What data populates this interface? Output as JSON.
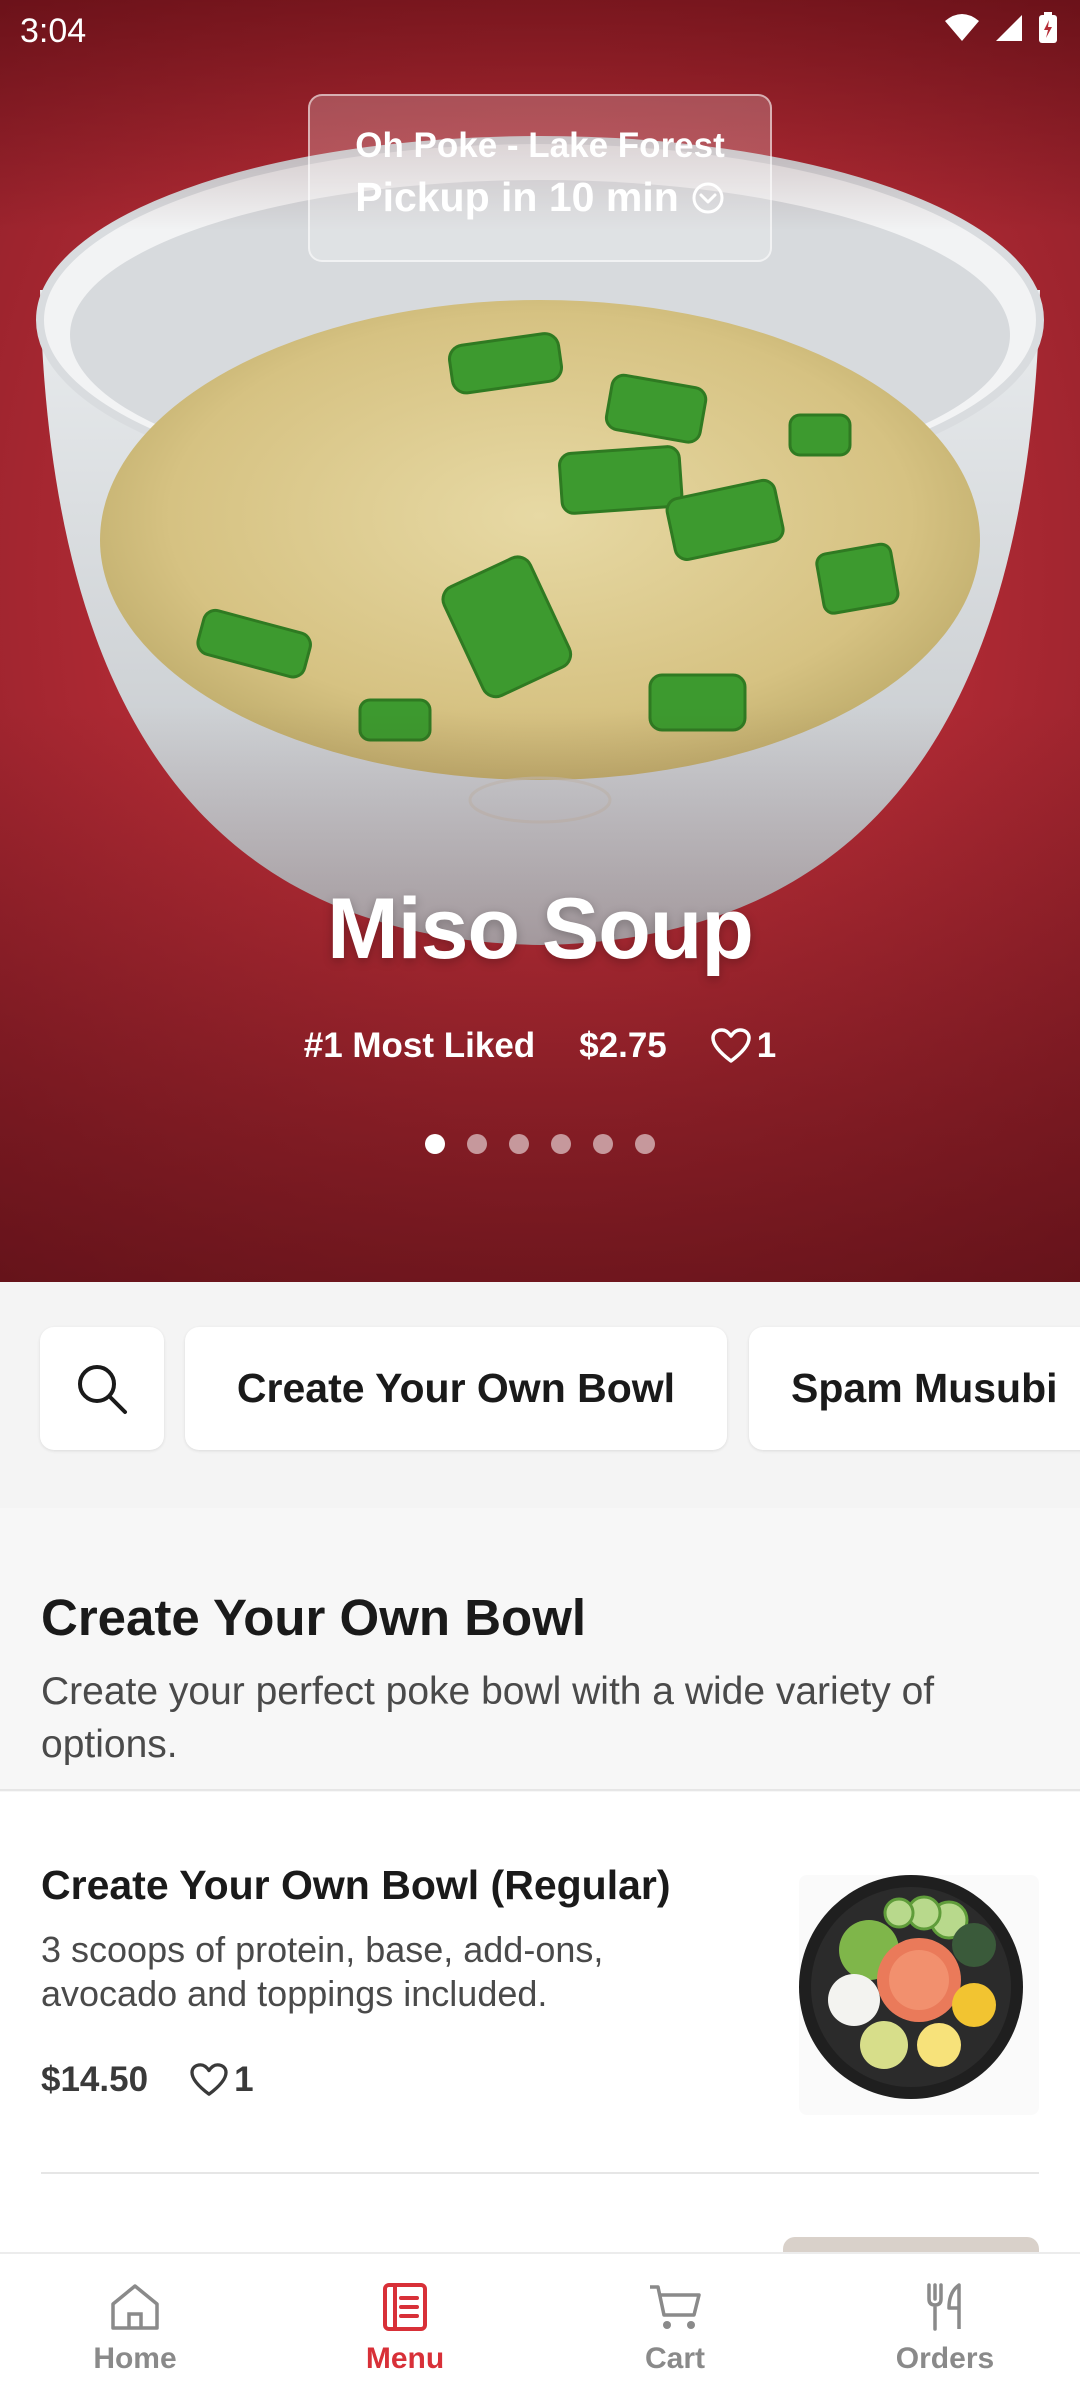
{
  "status_bar": {
    "time": "3:04"
  },
  "store": {
    "name": "Oh Poke - Lake Forest",
    "pickup": "Pickup in 10 min"
  },
  "hero": {
    "title": "Miso Soup",
    "rank": "#1 Most Liked",
    "price": "$2.75",
    "likes": "1",
    "carousel_total": 6,
    "carousel_active": 0
  },
  "categories": [
    "Create Your Own Bowl",
    "Spam Musubi"
  ],
  "section": {
    "title": "Create Your Own Bowl",
    "description": "Create your perfect poke bowl with a wide variety of options."
  },
  "items": [
    {
      "name": "Create Your Own Bowl (Regular)",
      "description": "3 scoops of protein, base, add-ons, avocado and toppings included.",
      "price": "$14.50",
      "likes": "1"
    }
  ],
  "nav": {
    "home": "Home",
    "menu": "Menu",
    "cart": "Cart",
    "orders": "Orders",
    "active": "menu"
  },
  "colors": {
    "accent": "#d83038",
    "hero_bg": "#b52c36"
  }
}
